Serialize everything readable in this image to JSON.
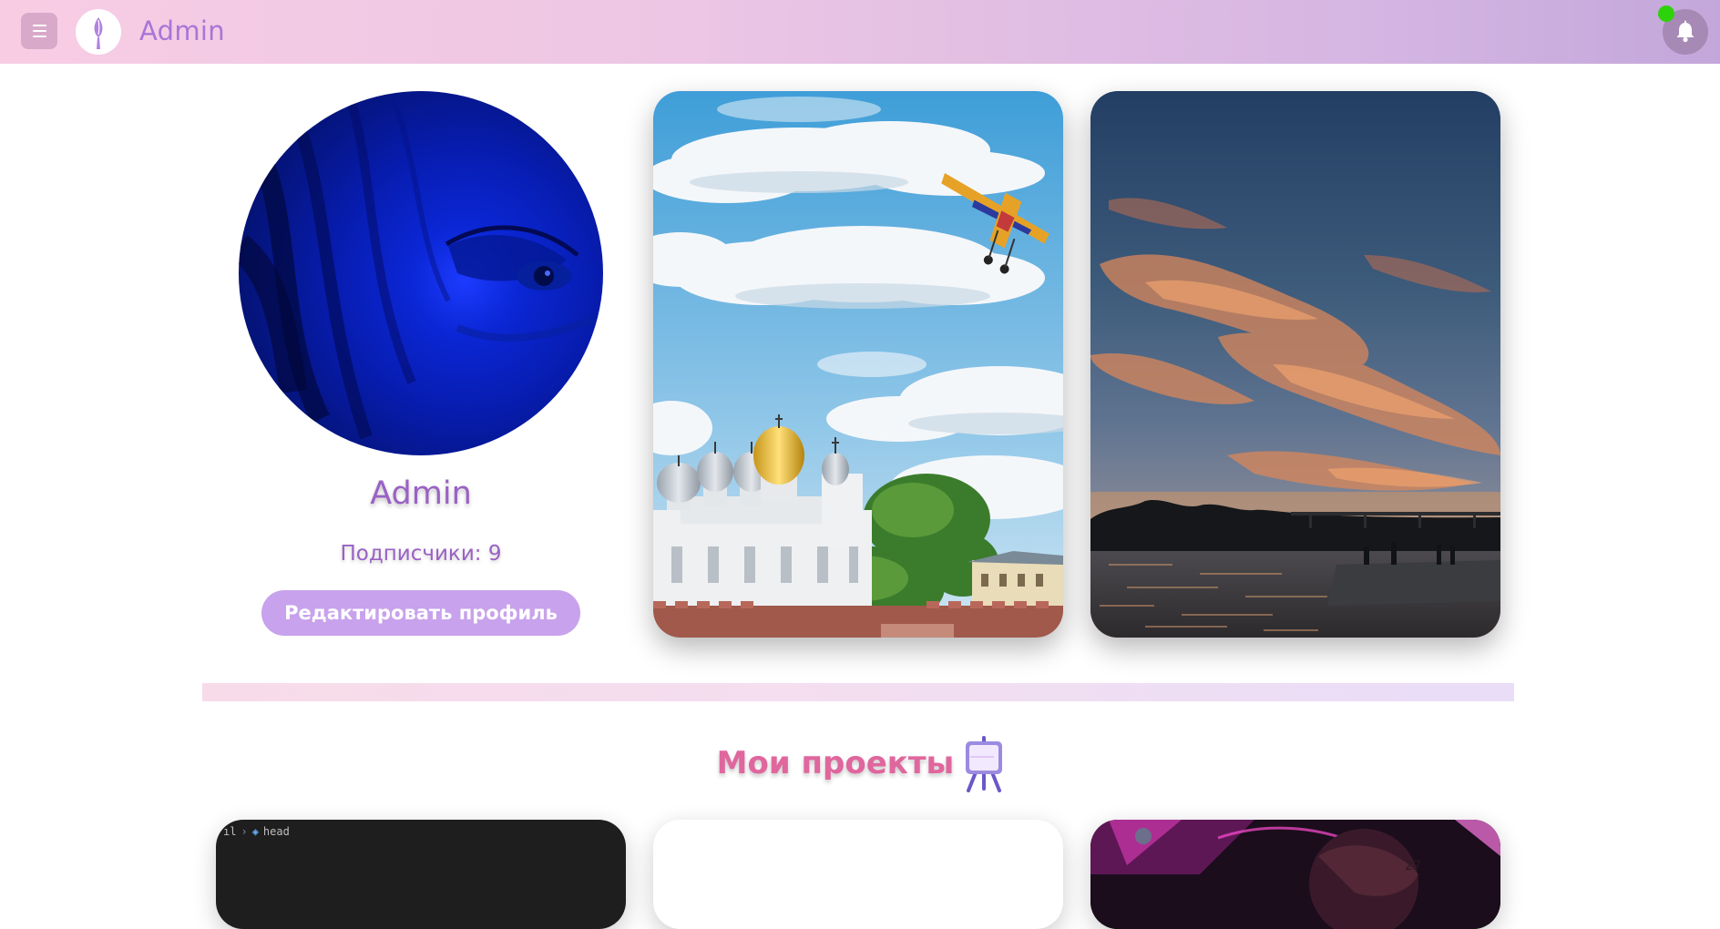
{
  "header": {
    "brand": "Admin",
    "menu_icon": "hamburger-menu-icon",
    "logo_icon": "feather-logo-icon",
    "notification_icon": "bell-icon",
    "online_status_color": "#2ed20a"
  },
  "profile": {
    "name": "Admin",
    "followers_label": "Подписчики: 9",
    "edit_button_label": "Редактировать профиль"
  },
  "photos": [
    {
      "subject": "Cathedral domes under cloudy sky with aerobatic plane"
    },
    {
      "subject": "Sunset over river with pier"
    }
  ],
  "projects": {
    "title": "Мои проекты",
    "title_icon": "easel-icon",
    "cards": [
      {
        "breadcrumb_prefix": "ıl",
        "breadcrumb_item": "head"
      },
      {},
      {}
    ]
  },
  "colors": {
    "header_gradient_start": "#f8cde4",
    "header_gradient_end": "#c3a7db",
    "accent_purple": "#9a62c4",
    "button_purple": "#c8a2ec",
    "projects_pink": "#e0669e"
  }
}
